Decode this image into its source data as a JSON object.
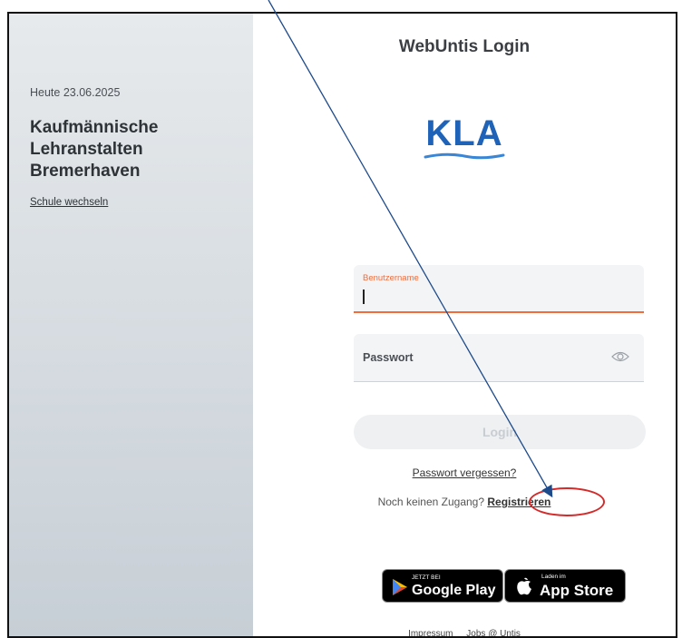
{
  "sidebar": {
    "date": "Heute 23.06.2025",
    "school_line1": "Kaufmännische",
    "school_line2": "Lehranstalten",
    "school_line3": "Bremerhaven",
    "switch_school": "Schule wechseln"
  },
  "main": {
    "title": "WebUntis Login",
    "logo_text": "KLA",
    "username_label": "Benutzername",
    "password_label": "Passwort",
    "login_label": "Login",
    "forgot_prefix": "Passwort vergessen",
    "forgot_suffix": "?",
    "no_access": "Noch keinen Zugang?",
    "register": "Registrieren"
  },
  "stores": {
    "google_small": "JETZT BEI",
    "google_big": "Google Play",
    "apple_small": "Laden im",
    "apple_big": "App Store"
  },
  "footer": {
    "impressum": "Impressum",
    "jobs": "Jobs @ Untis"
  },
  "colors": {
    "accent": "#f26b3a",
    "logo_blue": "#1f63b8",
    "annotation_red": "#d42a2a",
    "arrow_blue": "#1d4a8a"
  },
  "icons": {
    "password_toggle": "eye-icon",
    "google_play": "play-triangle-icon",
    "apple": "apple-icon"
  }
}
